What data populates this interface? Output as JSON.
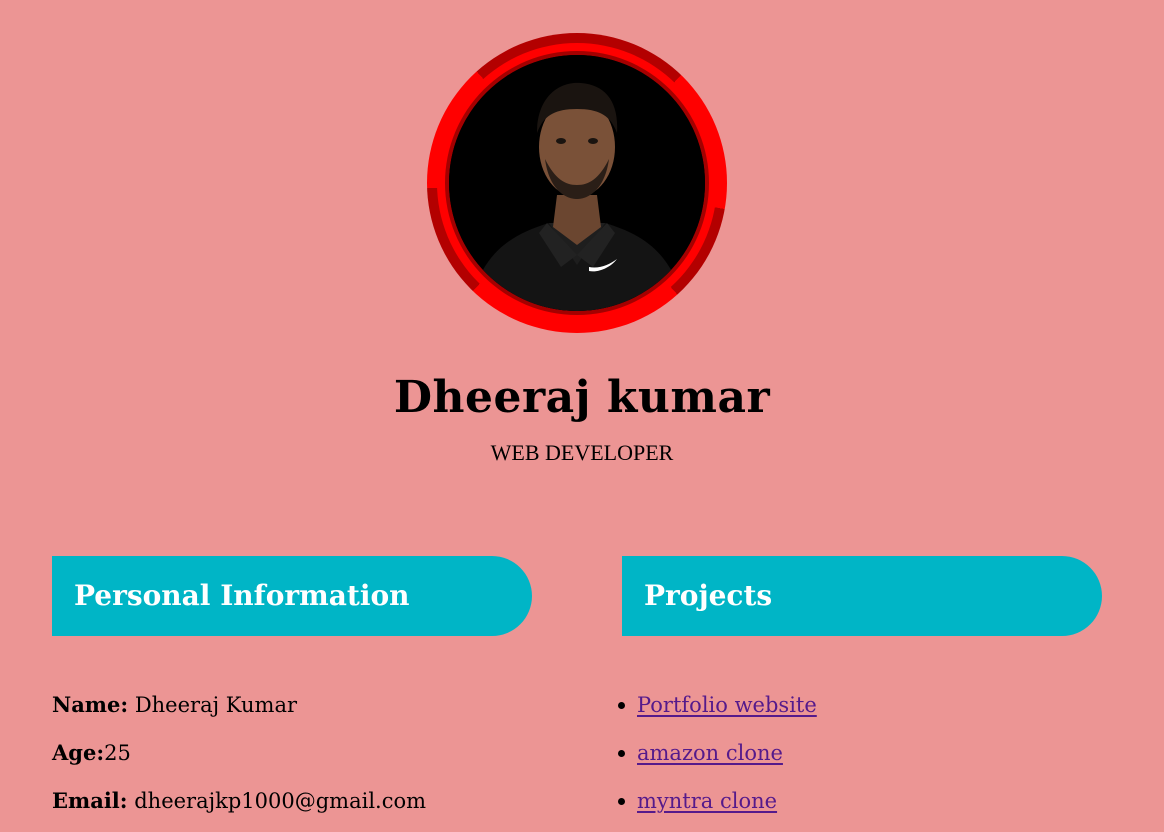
{
  "profile": {
    "name": "Dheeraj kumar",
    "role": "WEB DEVELOPER",
    "avatar_icon": "person-portrait-icon"
  },
  "colors": {
    "background": "#ec9594",
    "section_header": "#00b5c6",
    "ring_bright": "#ff0000",
    "ring_dark": "#b30000",
    "link_visited": "#551a8b"
  },
  "personal": {
    "heading": "Personal Information",
    "fields": [
      {
        "label": "Name:",
        "value": " Dheeraj Kumar"
      },
      {
        "label": "Age:",
        "value": "25"
      },
      {
        "label": "Email:",
        "value": " dheerajkp1000@gmail.com"
      }
    ]
  },
  "projects": {
    "heading": "Projects",
    "items": [
      {
        "label": "Portfolio website"
      },
      {
        "label": "amazon clone"
      },
      {
        "label": "myntra clone"
      }
    ]
  }
}
